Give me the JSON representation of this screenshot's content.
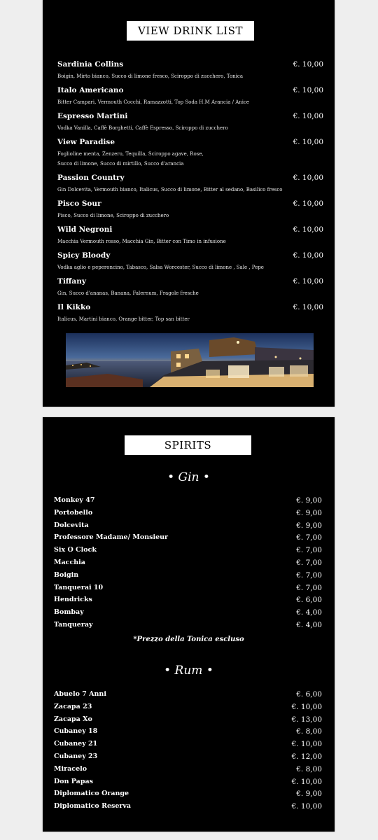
{
  "drink_list": {
    "title": "VIEW DRINK LIST",
    "items": [
      {
        "name": "Sardinia Collins",
        "price": "€. 10,00",
        "desc": [
          "Boigin, Mirto bianco, Succo di limone fresco, Sciroppo di zucchero, Tonica"
        ]
      },
      {
        "name": "Italo Americano",
        "price": "€. 10,00",
        "desc": [
          "Bitter Campari, Vermouth Cocchi, Ramazzotti, Top Soda H.M Arancia / Anice"
        ]
      },
      {
        "name": "Espresso Martini",
        "price": "€. 10,00",
        "desc": [
          "Vodka Vanilla, Caffè Borghetti, Caffè Espresso, Sciroppo di zucchero"
        ]
      },
      {
        "name": "View Paradise",
        "price": "€. 10,00",
        "desc": [
          "Foglioline menta, Zenzero, Tequilla, Sciroppo agave, Rose,",
          "Succo di limone, Succo di mirtillo, Succo d'arancia"
        ]
      },
      {
        "name": "Passion Country",
        "price": "€. 10,00",
        "desc": [
          "Gin Dolcevita, Vermouth bianco, Italicus, Succo di limone, Bitter al sedano, Basilico fresco"
        ]
      },
      {
        "name": "Pisco Sour",
        "price": "€. 10,00",
        "desc": [
          "Pisco, Succo di limone, Sciroppo di zucchero"
        ]
      },
      {
        "name": "Wild Negroni",
        "price": "€. 10,00",
        "desc": [
          "Macchia Vermouth rosso, Macchia Gin, Bitter con Timo in infusione"
        ]
      },
      {
        "name": "Spicy Bloody",
        "price": "€. 10,00",
        "desc": [
          "Vodka aglio e peperoncino, Tabasco, Salsa Worcester, Succo di limone , Sale , Pepe"
        ]
      },
      {
        "name": "Tiffany",
        "price": "€. 10,00",
        "desc": [
          "Gin, Succo d'ananas, Banana, Falernum, Fragole fresche"
        ]
      },
      {
        "name": "Il Kikko",
        "price": "€. 10,00",
        "desc": [
          "Italicus, Martini bianco, Orange bitter, Top san bitter"
        ]
      }
    ]
  },
  "spirits": {
    "title": "SPIRITS",
    "gin": {
      "heading": "• Gin •",
      "items": [
        {
          "name": "Monkey 47",
          "price": "€. 9,00"
        },
        {
          "name": "Portobello",
          "price": "€. 9,00"
        },
        {
          "name": "Dolcevita",
          "price": "€. 9,00"
        },
        {
          "name": "Professore Madame/ Monsieur",
          "price": "€. 7,00"
        },
        {
          "name": "Six O Clock",
          "price": "€. 7,00"
        },
        {
          "name": "Macchia",
          "price": "€. 7,00"
        },
        {
          "name": "Boigin",
          "price": "€. 7,00"
        },
        {
          "name": "Tanquerai 10",
          "price": "€. 7,00"
        },
        {
          "name": "Hendricks",
          "price": "€. 6,00"
        },
        {
          "name": "Bombay",
          "price": "€. 4,00"
        },
        {
          "name": "Tanqueray",
          "price": "€. 4,00"
        }
      ],
      "note": "*Prezzo della Tonica escluso"
    },
    "rum": {
      "heading": "• Rum •",
      "items": [
        {
          "name": "Abuelo 7 Anni",
          "price": "€. 6,00"
        },
        {
          "name": "Zacapa 23",
          "price": "€. 10,00"
        },
        {
          "name": "Zacapa Xo",
          "price": "€. 13,00"
        },
        {
          "name": "Cubaney 18",
          "price": "€. 8,00"
        },
        {
          "name": "Cubaney 21",
          "price": "€. 10,00"
        },
        {
          "name": "Cubaney 23",
          "price": "€. 12,00"
        },
        {
          "name": "Miracelo",
          "price": "€. 8,00"
        },
        {
          "name": "Don Papas",
          "price": "€. 10,00"
        },
        {
          "name": "Diplomatico Orange",
          "price": "€. 9,00"
        },
        {
          "name": "Diplomatico Reserva",
          "price": "€. 10,00"
        }
      ]
    }
  }
}
